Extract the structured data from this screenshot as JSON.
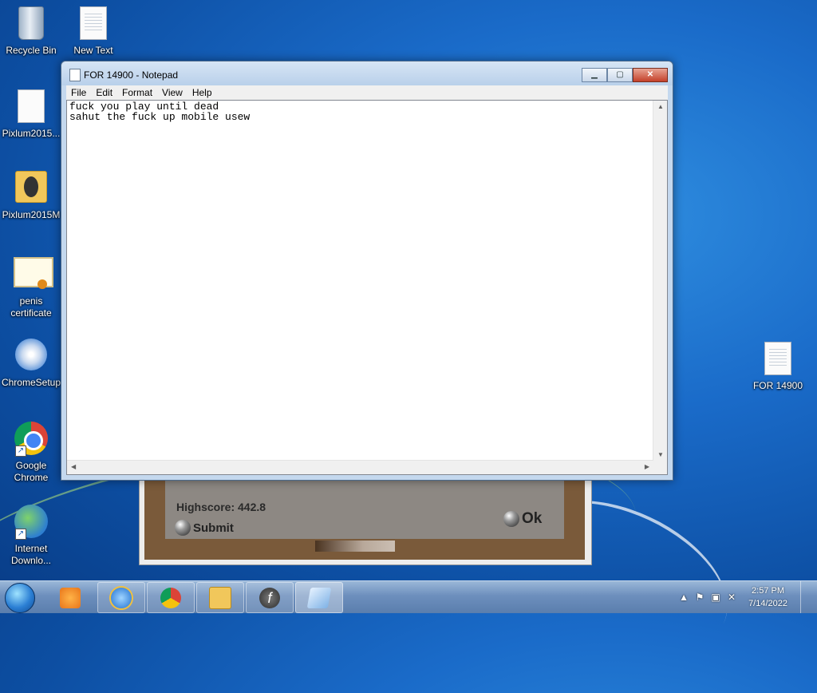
{
  "desktop": {
    "left_icons": [
      {
        "label": "Recycle Bin"
      },
      {
        "label": "New Text"
      },
      {
        "label": "Pixlum2015..."
      },
      {
        "label": "Pixlum2015M"
      },
      {
        "label": "penis certificate"
      },
      {
        "label": "ChromeSetup"
      },
      {
        "label": "Google Chrome"
      },
      {
        "label": "Internet Downlo..."
      }
    ],
    "right_icon": {
      "label": "FOR 14900"
    }
  },
  "game_dialog": {
    "highscore": "Highscore: 442.8",
    "submit_label": "Submit",
    "ok_label": "Ok"
  },
  "notepad": {
    "title": "FOR 14900 - Notepad",
    "menu": [
      "File",
      "Edit",
      "Format",
      "View",
      "Help"
    ],
    "content": "fuck you play until dead\nsahut the fuck up mobile usew"
  },
  "taskbar": {
    "apps": [
      "windows-media-player",
      "internet-explorer",
      "google-chrome",
      "windows-explorer",
      "flash-player",
      "notepad"
    ],
    "clock_time": "2:57 PM",
    "clock_date": "7/14/2022"
  }
}
